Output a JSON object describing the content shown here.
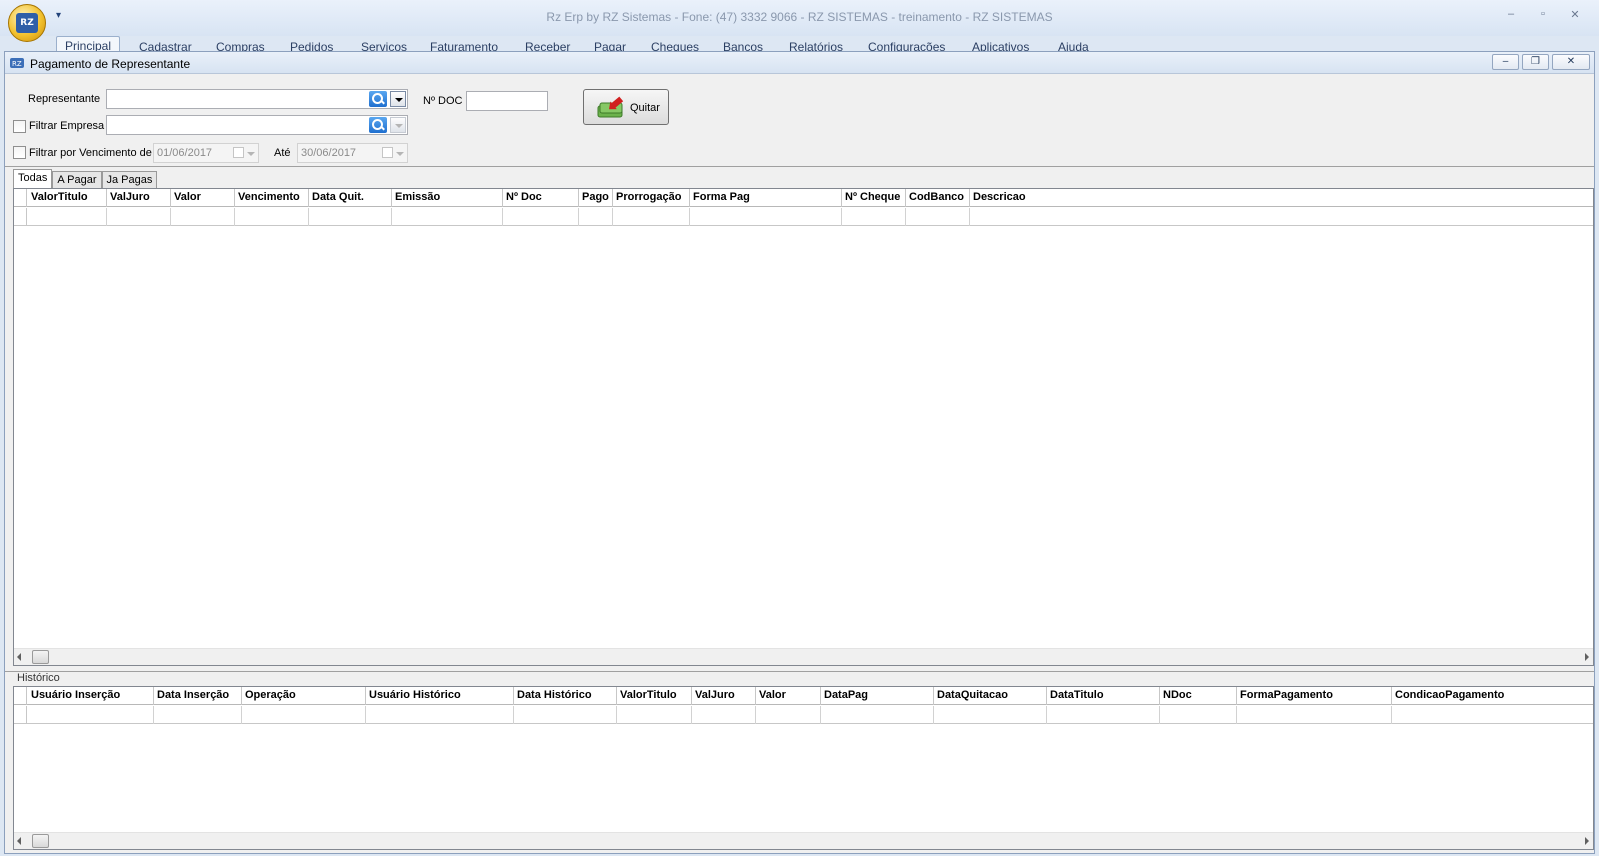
{
  "app": {
    "title": "Rz Erp by RZ Sistemas - Fone: (47) 3332 9066 - RZ SISTEMAS - treinamento - RZ SISTEMAS",
    "qat_symbol": "▾",
    "minimize": "‒",
    "maximize": "▫",
    "close": "✕"
  },
  "ribbon": {
    "tabs": [
      "Principal",
      "Cadastrar",
      "Compras",
      "Pedidos",
      "Serviços",
      "Faturamento",
      "Receber",
      "Pagar",
      "Cheques",
      "Bancos",
      "Relatórios",
      "Configurações",
      "Aplicativos",
      "Ajuda"
    ],
    "active": "Principal"
  },
  "window": {
    "title": "Pagamento de Representante",
    "minimize": "–",
    "restore": "❐",
    "close": "✕"
  },
  "form": {
    "representante_label": "Representante",
    "representante_value": "",
    "filtrar_empresa_label": "Filtrar Empresa",
    "filtrar_empresa_checked": false,
    "empresa_value": "",
    "filtrar_vencimento_label": "Filtrar por Vencimento de",
    "filtrar_vencimento_checked": false,
    "date_from": "01/06/2017",
    "ate_label": "Até",
    "date_to": "30/06/2017",
    "ndoc_label": "Nº DOC",
    "ndoc_value": "",
    "quitar_label": "Quitar"
  },
  "tabs": [
    "Todas",
    "A Pagar",
    "Ja Pagas"
  ],
  "active_tab": "Todas",
  "main_grid": {
    "columns": [
      "ValorTitulo",
      "ValJuro",
      "Valor",
      "Vencimento",
      "Data Quit.",
      "Emissão",
      "Nº Doc",
      "Pago",
      "Prorrogação",
      "Forma Pag",
      "Nº Cheque",
      "CodBanco",
      "Descricao"
    ],
    "rows": []
  },
  "historico": {
    "label": "Histórico",
    "columns": [
      "Usuário Inserção",
      "Data Inserção",
      "Operação",
      "Usuário Histórico",
      "Data Histórico",
      "ValorTitulo",
      "ValJuro",
      "Valor",
      "DataPag",
      "DataQuitacao",
      "DataTitulo",
      "NDoc",
      "FormaPagamento",
      "CondicaoPagamento"
    ],
    "rows": []
  }
}
